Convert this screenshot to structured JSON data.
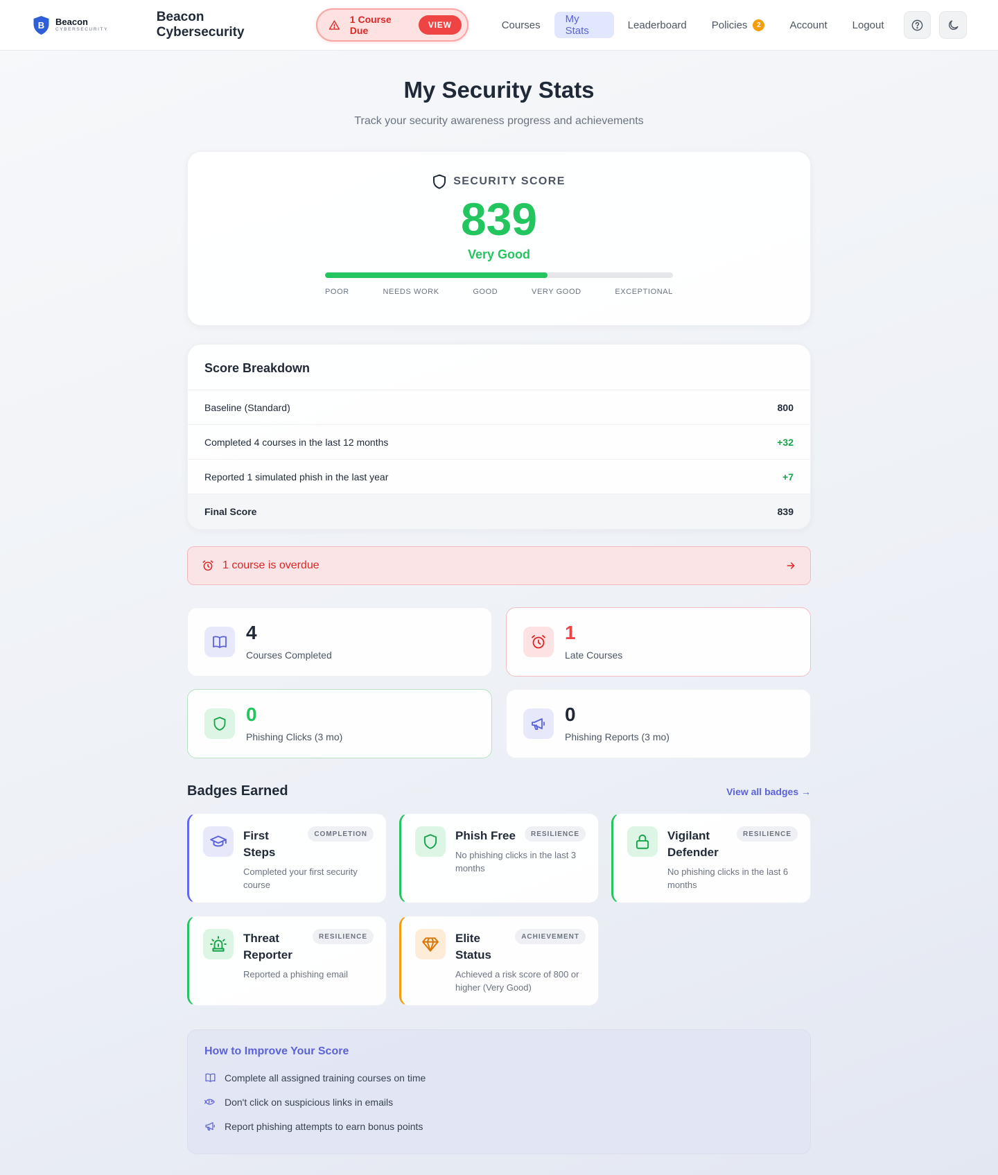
{
  "logo": {
    "name": "Beacon",
    "sub": "CYBERSECURITY"
  },
  "header": {
    "brand": "Beacon Cybersecurity",
    "due_text": "1 Course Due",
    "view_label": "VIEW",
    "nav": [
      {
        "label": "Courses"
      },
      {
        "label": "My Stats"
      },
      {
        "label": "Leaderboard"
      },
      {
        "label": "Policies",
        "badge": "2"
      },
      {
        "label": "Account"
      },
      {
        "label": "Logout"
      }
    ]
  },
  "page": {
    "title": "My Security Stats",
    "subtitle": "Track your security awareness progress and achievements"
  },
  "score": {
    "label": "SECURITY SCORE",
    "value": "839",
    "rating": "Very Good",
    "progress_percent": 64,
    "ticks": [
      "POOR",
      "NEEDS WORK",
      "GOOD",
      "VERY GOOD",
      "EXCEPTIONAL"
    ]
  },
  "breakdown": {
    "title": "Score Breakdown",
    "rows": [
      {
        "label": "Baseline (Standard)",
        "value": "800"
      },
      {
        "label": "Completed 4 courses in the last 12 months",
        "value": "+32"
      },
      {
        "label": "Reported 1 simulated phish in the last year",
        "value": "+7"
      }
    ],
    "final": {
      "label": "Final Score",
      "value": "839"
    }
  },
  "overdue": {
    "text": "1 course is overdue"
  },
  "stats": [
    {
      "value": "4",
      "label": "Courses Completed"
    },
    {
      "value": "1",
      "label": "Late Courses"
    },
    {
      "value": "0",
      "label": "Phishing Clicks (3 mo)"
    },
    {
      "value": "0",
      "label": "Phishing Reports (3 mo)"
    }
  ],
  "badges": {
    "title": "Badges Earned",
    "view_all": "View all badges →",
    "items": [
      {
        "name": "First Steps",
        "tag": "COMPLETION",
        "desc": "Completed your first security course"
      },
      {
        "name": "Phish Free",
        "tag": "RESILIENCE",
        "desc": "No phishing clicks in the last 3 months"
      },
      {
        "name": "Vigilant Defender",
        "tag": "RESILIENCE",
        "desc": "No phishing clicks in the last 6 months"
      },
      {
        "name": "Threat Reporter",
        "tag": "RESILIENCE",
        "desc": "Reported a phishing email"
      },
      {
        "name": "Elite Status",
        "tag": "ACHIEVEMENT",
        "desc": "Achieved a risk score of 800 or higher (Very Good)"
      }
    ]
  },
  "improve": {
    "title": "How to Improve Your Score",
    "tips": [
      "Complete all assigned training courses on time",
      "Don't click on suspicious links in emails",
      "Report phishing attempts to earn bonus points"
    ]
  },
  "colors": {
    "accent": "#5b62d8",
    "success": "#22c55e",
    "danger": "#ef4444",
    "warning": "#f59e0b"
  }
}
